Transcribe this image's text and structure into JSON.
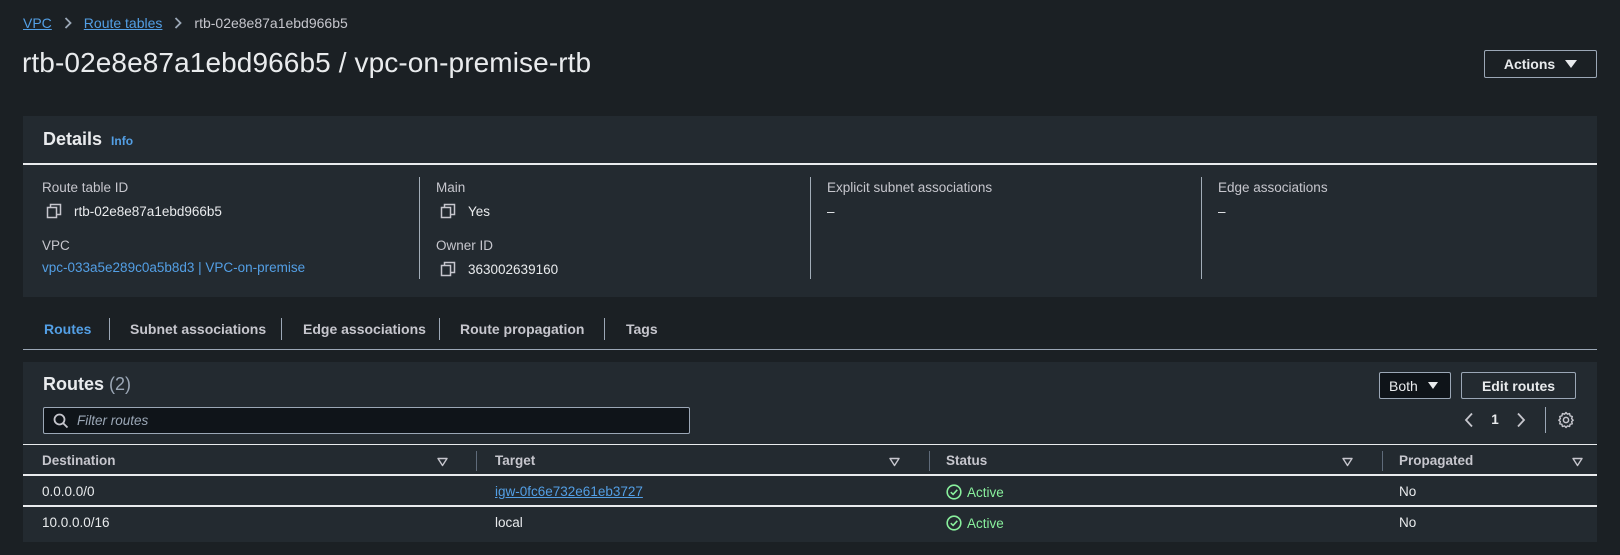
{
  "breadcrumb": {
    "items": [
      {
        "label": "VPC"
      },
      {
        "label": "Route tables"
      },
      {
        "label": "rtb-02e8e87a1ebd966b5"
      }
    ]
  },
  "header": {
    "title": "rtb-02e8e87a1ebd966b5 / vpc-on-premise-rtb",
    "actions_label": "Actions"
  },
  "details": {
    "title": "Details",
    "info_label": "Info",
    "route_table_id_label": "Route table ID",
    "route_table_id": "rtb-02e8e87a1ebd966b5",
    "vpc_label": "VPC",
    "vpc_value": "vpc-033a5e289c0a5b8d3 | VPC-on-premise",
    "main_label": "Main",
    "main_value": "Yes",
    "owner_id_label": "Owner ID",
    "owner_id": "363002639160",
    "explicit_subnet_label": "Explicit subnet associations",
    "explicit_subnet_value": "–",
    "edge_assoc_label": "Edge associations",
    "edge_assoc_value": "–"
  },
  "tabs": [
    {
      "label": "Routes",
      "active": true
    },
    {
      "label": "Subnet associations",
      "active": false
    },
    {
      "label": "Edge associations",
      "active": false
    },
    {
      "label": "Route propagation",
      "active": false
    },
    {
      "label": "Tags",
      "active": false
    }
  ],
  "routes": {
    "title": "Routes",
    "count": "(2)",
    "filter_select_value": "Both",
    "edit_routes_label": "Edit routes",
    "filter_placeholder": "Filter routes",
    "page": "1",
    "columns": [
      "Destination",
      "Target",
      "Status",
      "Propagated"
    ],
    "rows": [
      {
        "destination": "0.0.0.0/0",
        "target": "igw-0fc6e732e61eb3727",
        "target_is_link": true,
        "status": "Active",
        "propagated": "No"
      },
      {
        "destination": "10.0.0.0/16",
        "target": "local",
        "target_is_link": false,
        "status": "Active",
        "propagated": "No"
      }
    ]
  },
  "colors": {
    "background": "#1b2024",
    "panel": "#232a30",
    "link": "#539fe5",
    "status_active": "#89f09d"
  }
}
